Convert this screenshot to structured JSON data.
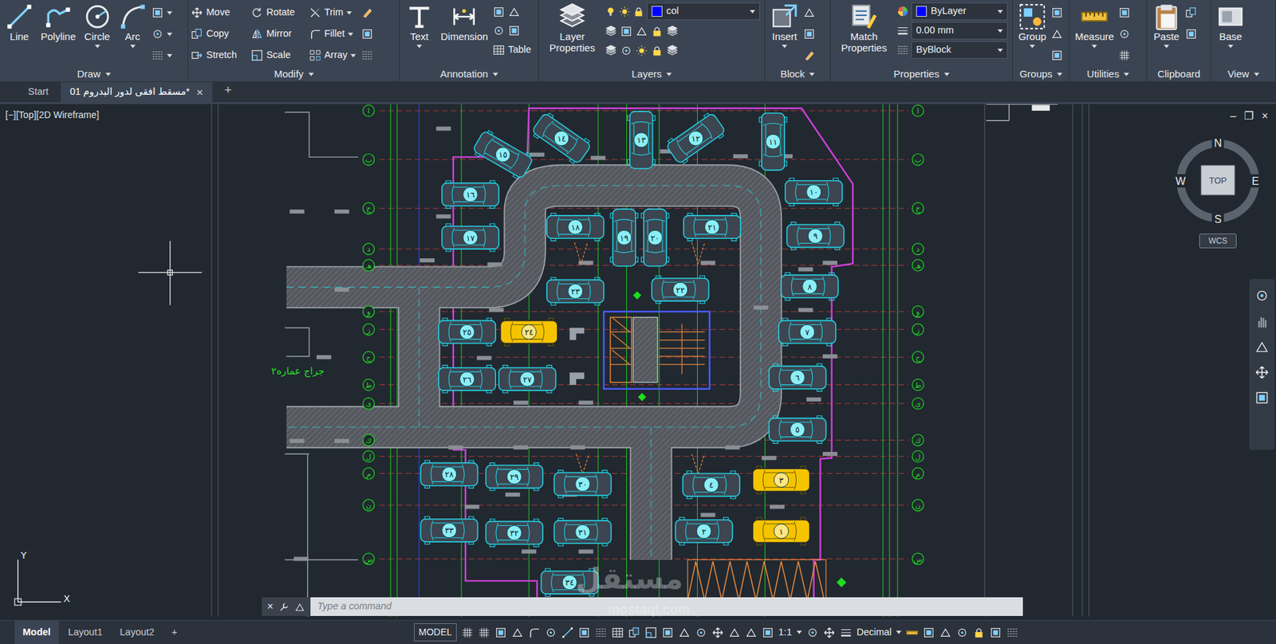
{
  "ribbon": {
    "panels": [
      {
        "label": "Draw",
        "menu": true,
        "large": [
          {
            "label": "Line",
            "dropdown": false
          },
          {
            "label": "Polyline",
            "dropdown": false
          },
          {
            "label": "Circle",
            "dropdown": true
          },
          {
            "label": "Arc",
            "dropdown": true
          }
        ],
        "small": [],
        "fields": []
      },
      {
        "label": "Modify",
        "menu": true,
        "large": [],
        "small": [
          {
            "label": "Move",
            "dropdown": false
          },
          {
            "label": "Rotate",
            "dropdown": false
          },
          {
            "label": "Trim",
            "dropdown": true
          },
          {
            "label": "Copy",
            "dropdown": false
          },
          {
            "label": "Mirror",
            "dropdown": false
          },
          {
            "label": "Fillet",
            "dropdown": true
          },
          {
            "label": "Stretch",
            "dropdown": false
          },
          {
            "label": "Scale",
            "dropdown": false
          },
          {
            "label": "Array",
            "dropdown": true
          }
        ],
        "fields": []
      },
      {
        "label": "Annotation",
        "menu": true,
        "large": [
          {
            "label": "Text",
            "dropdown": true
          },
          {
            "label": "Dimension",
            "dropdown": false
          }
        ],
        "small": [
          {
            "label": "Table",
            "dropdown": false
          }
        ],
        "fields": []
      },
      {
        "label": "Layers",
        "menu": true,
        "large": [
          {
            "label": "Layer Properties",
            "dropdown": false
          }
        ],
        "small": [],
        "fields": [
          {
            "text": "col",
            "swatch": "#0000ff"
          }
        ]
      },
      {
        "label": "Block",
        "menu": true,
        "large": [
          {
            "label": "Insert",
            "dropdown": true
          }
        ],
        "small": [],
        "fields": []
      },
      {
        "label": "Properties",
        "menu": true,
        "large": [
          {
            "label": "Match Properties",
            "dropdown": false
          }
        ],
        "small": [],
        "fields": [
          {
            "text": "ByLayer",
            "swatch": "#0000ff"
          },
          {
            "text": "0.00 mm"
          },
          {
            "text": "ByBlock"
          }
        ]
      },
      {
        "label": "Groups",
        "menu": true,
        "large": [
          {
            "label": "Group",
            "dropdown": true
          }
        ],
        "small": [],
        "fields": []
      },
      {
        "label": "Utilities",
        "menu": true,
        "large": [
          {
            "label": "Measure",
            "dropdown": true
          }
        ],
        "small": [],
        "fields": []
      },
      {
        "label": "Clipboard",
        "menu": false,
        "large": [
          {
            "label": "Paste",
            "dropdown": true
          }
        ],
        "small": [],
        "fields": []
      },
      {
        "label": "View",
        "menu": true,
        "large": [
          {
            "label": "Base",
            "dropdown": true
          }
        ],
        "small": [],
        "fields": []
      }
    ]
  },
  "file_tabs": {
    "tabs": [
      {
        "label": "Start",
        "selected": false,
        "closable": false
      },
      {
        "label": "مسقط افقى لدور البدروم 01*",
        "selected": true,
        "closable": true
      }
    ],
    "close": "×",
    "add": "+"
  },
  "viewport": {
    "label": "[−][Top][2D Wireframe]",
    "controls": [
      "–",
      "❐",
      "×"
    ],
    "viewcube": {
      "north": "N",
      "south": "S",
      "east": "E",
      "west": "W",
      "face": "TOP",
      "ucs": "WCS"
    },
    "ucs_icon": {
      "x": "X",
      "y": "Y"
    }
  },
  "drawing": {
    "title": "جراج عماره٢",
    "grid_bubbles": [
      "ا",
      "ب",
      "ج",
      "د",
      "هـ",
      "و",
      "ز",
      "ح",
      "ط",
      "ى",
      "ك",
      "ل",
      "م",
      "ن",
      "س",
      "ع"
    ],
    "cars": [
      {
        "label": "١٥",
        "color": "#22d3e6",
        "highlighted": false
      },
      {
        "label": "١٤",
        "color": "#22d3e6",
        "highlighted": false
      },
      {
        "label": "١٣",
        "color": "#22d3e6",
        "highlighted": false
      },
      {
        "label": "١٢",
        "color": "#22d3e6",
        "highlighted": false
      },
      {
        "label": "١١",
        "color": "#22d3e6",
        "highlighted": false
      },
      {
        "label": "١٦",
        "color": "#22d3e6",
        "highlighted": false
      },
      {
        "label": "١٧",
        "color": "#22d3e6",
        "highlighted": false
      },
      {
        "label": "١٠",
        "color": "#22d3e6",
        "highlighted": false
      },
      {
        "label": "٩",
        "color": "#22d3e6",
        "highlighted": false
      },
      {
        "label": "١٨",
        "color": "#22d3e6",
        "highlighted": false
      },
      {
        "label": "١٩",
        "color": "#22d3e6",
        "highlighted": false
      },
      {
        "label": "٢٠",
        "color": "#22d3e6",
        "highlighted": false
      },
      {
        "label": "٢١",
        "color": "#22d3e6",
        "highlighted": false
      },
      {
        "label": "٢٣",
        "color": "#22d3e6",
        "highlighted": false
      },
      {
        "label": "٢٢",
        "color": "#22d3e6",
        "highlighted": false
      },
      {
        "label": "٨",
        "color": "#22d3e6",
        "highlighted": false
      },
      {
        "label": "٢٥",
        "color": "#22d3e6",
        "highlighted": false
      },
      {
        "label": "٢٤",
        "color": "#f5c400",
        "highlighted": true
      },
      {
        "label": "٧",
        "color": "#22d3e6",
        "highlighted": false
      },
      {
        "label": "٢٦",
        "color": "#22d3e6",
        "highlighted": false
      },
      {
        "label": "٢٧",
        "color": "#22d3e6",
        "highlighted": false
      },
      {
        "label": "٦",
        "color": "#22d3e6",
        "highlighted": false
      },
      {
        "label": "٥",
        "color": "#22d3e6",
        "highlighted": false
      },
      {
        "label": "٢٨",
        "color": "#22d3e6",
        "highlighted": false
      },
      {
        "label": "٢٩",
        "color": "#22d3e6",
        "highlighted": false
      },
      {
        "label": "٣٠",
        "color": "#22d3e6",
        "highlighted": false
      },
      {
        "label": "٤",
        "color": "#22d3e6",
        "highlighted": false
      },
      {
        "label": "٣",
        "color": "#f5c400",
        "highlighted": true
      },
      {
        "label": "٣٣",
        "color": "#22d3e6",
        "highlighted": false
      },
      {
        "label": "٣٢",
        "color": "#22d3e6",
        "highlighted": false
      },
      {
        "label": "٣١",
        "color": "#22d3e6",
        "highlighted": false
      },
      {
        "label": "٢",
        "color": "#22d3e6",
        "highlighted": false
      },
      {
        "label": "١",
        "color": "#f5c400",
        "highlighted": true
      },
      {
        "label": "٣٤",
        "color": "#22d3e6",
        "highlighted": false
      }
    ]
  },
  "watermark": [
    "مستقل",
    "mostaql.com"
  ],
  "command_line": {
    "close": "×",
    "placeholder": "Type a command"
  },
  "status_bar": {
    "layout_tabs": [
      {
        "label": "Model",
        "selected": true
      },
      {
        "label": "Layout1",
        "selected": false
      },
      {
        "label": "Layout2",
        "selected": false
      }
    ],
    "add": "+",
    "model_button": "MODEL",
    "scale": "1:1",
    "units": "Decimal"
  }
}
